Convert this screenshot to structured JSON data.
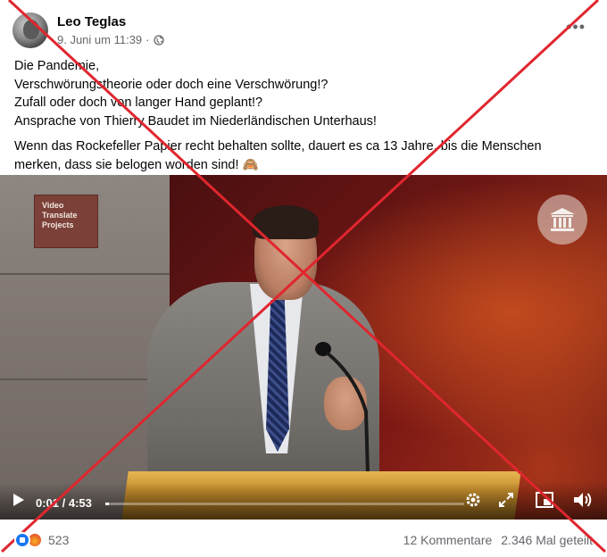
{
  "post": {
    "author": "Leo Teglas",
    "timestamp": "9. Juni um 11:39",
    "separator": "·",
    "privacy_icon": "globe-icon",
    "more_label": "•••",
    "text_lines": [
      "Die Pandemie,",
      "Verschwörungstheorie oder doch eine Verschwörung!?",
      "Zufall oder doch von langer Hand geplant!?",
      "Ansprache von Thierry Baudet im Niederländischen Unterhaus!"
    ],
    "text_paragraph2_line1": "Wenn das Rockefeller Papier recht behalten sollte, dauert es ca 13 Jahre, bis die Menschen",
    "text_paragraph2_line2": "merken, dass sie belogen worden sind! 🙈"
  },
  "video": {
    "sign_lines": [
      "Video",
      "Translate",
      "Projects"
    ],
    "time_label": "0:01 / 4:53",
    "progress_fraction": 0.0034,
    "controls": [
      "play-icon",
      "settings-icon",
      "fullscreen-expand-icon",
      "picture-in-picture-icon",
      "volume-icon"
    ]
  },
  "footer": {
    "reaction_count": "523",
    "reactions": [
      "like",
      "angry"
    ],
    "comments": "12 Kommentare",
    "shares": "2.346 Mal geteilt"
  },
  "overlay": {
    "x_mark_color": "#e0262e"
  }
}
